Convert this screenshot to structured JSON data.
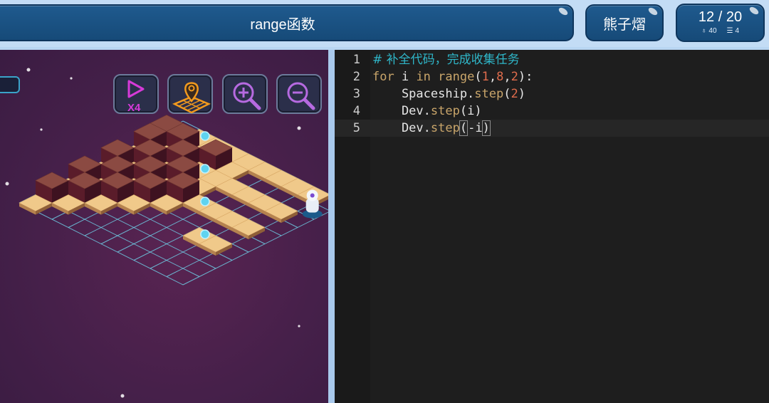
{
  "header": {
    "title": "range函数",
    "user_name": "熊子熠",
    "level": "12 / 20",
    "stat_rank": "40",
    "stat_lines": "4",
    "rank_icon": "rank-icon",
    "lines_icon": "list-icon"
  },
  "toolbar": {
    "speed_label": "X4",
    "buttons": [
      "speed-x4",
      "map-view",
      "zoom-in",
      "zoom-out"
    ]
  },
  "editor": {
    "lines": [
      {
        "n": "1",
        "comment": "# 补全代码，完成收集任务"
      },
      {
        "n": "2",
        "kw1": "for",
        "t1": " i ",
        "kw2": "in",
        "t2": " ",
        "fn": "range",
        "p1": "(",
        "a": "1",
        "c1": ",",
        "b": "8",
        "c2": ",",
        "c": "2",
        "p2": "):"
      },
      {
        "n": "3",
        "obj": "    Spaceship.",
        "fn": "step",
        "p1": "(",
        "arg": "2",
        "p2": ")"
      },
      {
        "n": "4",
        "obj": "    Dev.",
        "fn": "step",
        "p1": "(",
        "arg": "i",
        "p2": ")"
      },
      {
        "n": "5",
        "obj": "    Dev.",
        "fn": "step",
        "p1": "(",
        "arg": "-i",
        "p2": ")"
      }
    ]
  },
  "colors": {
    "header_bg": "#1f5a8e",
    "game_bg": "#46204a",
    "editor_bg": "#1e1e1e",
    "comment": "#2fb7c9",
    "keyword": "#c9a56a",
    "number": "#e06c4c",
    "tile_light": "#f0c98a",
    "block_top": "#8b4a42",
    "grid": "#6fd0e8"
  }
}
